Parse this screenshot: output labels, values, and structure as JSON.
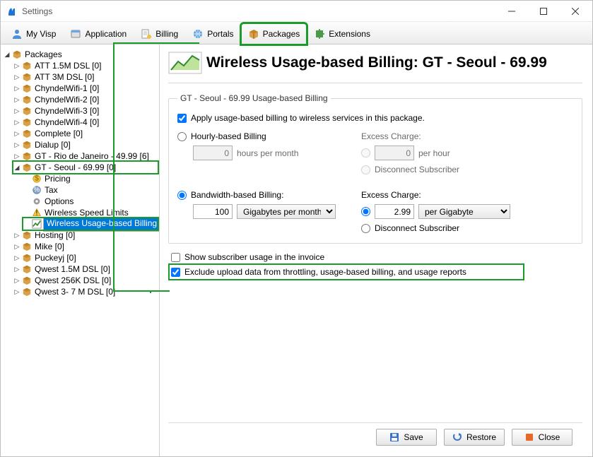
{
  "window": {
    "title": "Settings"
  },
  "tabs": [
    {
      "label": "My Visp"
    },
    {
      "label": "Application"
    },
    {
      "label": "Billing"
    },
    {
      "label": "Portals"
    },
    {
      "label": "Packages"
    },
    {
      "label": "Extensions"
    }
  ],
  "tree": {
    "root_label": "Packages",
    "items": [
      {
        "label": "ATT 1.5M DSL [0]"
      },
      {
        "label": "ATT 3M DSL [0]"
      },
      {
        "label": "ChyndelWifi-1 [0]"
      },
      {
        "label": "ChyndelWifi-2 [0]"
      },
      {
        "label": "ChyndelWifi-3 [0]"
      },
      {
        "label": "ChyndelWifi-4 [0]"
      },
      {
        "label": "Complete [0]"
      },
      {
        "label": "Dialup [0]"
      },
      {
        "label": "GT - Rio de Janeiro - 49.99 [6]"
      },
      {
        "label": "GT - Seoul - 69.99 [0]",
        "expanded": true,
        "children": [
          {
            "label": "Pricing"
          },
          {
            "label": "Tax"
          },
          {
            "label": "Options"
          },
          {
            "label": "Wireless Speed Limits"
          },
          {
            "label": "Wireless Usage-based Billing",
            "selected": true
          }
        ]
      },
      {
        "label": "Hosting [0]"
      },
      {
        "label": "Mike [0]"
      },
      {
        "label": "Puckeyj [0]"
      },
      {
        "label": "Qwest 1.5M DSL [0]"
      },
      {
        "label": "Qwest 256K DSL [0]"
      },
      {
        "label": "Qwest 3- 7 M DSL [0]"
      }
    ]
  },
  "page": {
    "title": "Wireless Usage-based Billing: GT - Seoul - 69.99",
    "legend": "GT - Seoul - 69.99 Usage-based Billing",
    "apply_label": "Apply usage-based billing to wireless services in this package.",
    "hourly_label": "Hourly-based Billing",
    "hourly_value": "0",
    "hourly_unit": "hours per month",
    "excess_label": "Excess Charge:",
    "per_hour_value": "0",
    "per_hour_unit": "per hour",
    "disconnect_label": "Disconnect Subscriber",
    "bw_label": "Bandwidth-based Billing:",
    "bw_value": "100",
    "bw_unit": "Gigabytes per month",
    "bw_excess_value": "2.99",
    "bw_excess_unit": "per Gigabyte",
    "show_usage_label": "Show subscriber usage in the invoice",
    "exclude_label": "Exclude upload data from throttling, usage-based billing, and usage reports"
  },
  "buttons": {
    "save": "Save",
    "restore": "Restore",
    "close": "Close"
  }
}
